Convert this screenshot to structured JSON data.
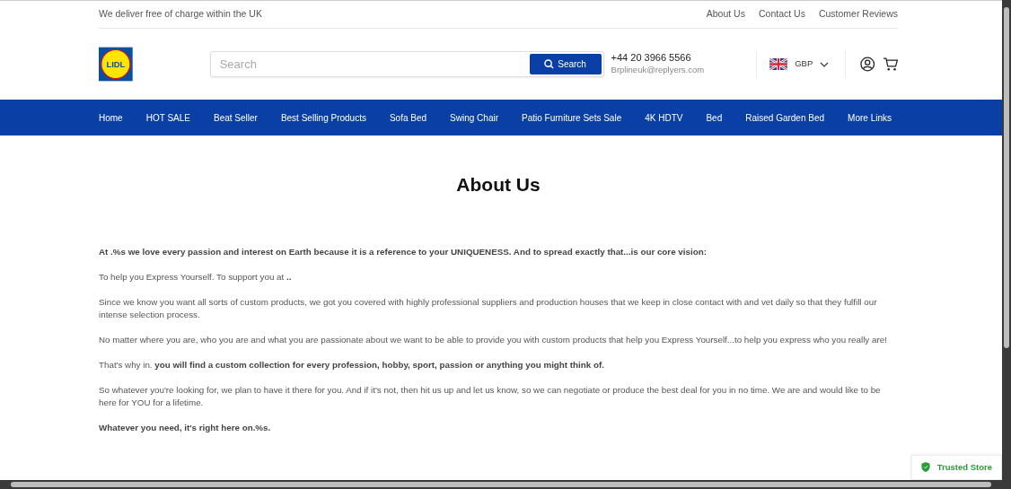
{
  "topbar": {
    "message": "We deliver free of charge within the UK",
    "links": [
      "About Us",
      "Contact Us",
      "Customer Reviews"
    ]
  },
  "header": {
    "logo": {
      "text": "LIDL"
    },
    "search": {
      "placeholder": "Search",
      "button": "Search"
    },
    "contact": {
      "phone": "+44 20 3966 5566",
      "email": "Brplineuk@replyers.com"
    },
    "currency": "GBP"
  },
  "nav": [
    "Home",
    "HOT SALE",
    "Beat Seller",
    "Best Selling Products",
    "Sofa Bed",
    "Swing Chair",
    "Patio Furniture Sets Sale",
    "4K HDTV",
    "Bed",
    "Raised Garden Bed",
    "More Links"
  ],
  "page": {
    "title": "About Us",
    "paragraphs": [
      {
        "text": "At .%s we love every passion and interest on Earth because it is a reference to your UNIQUENESS. And to spread exactly that...is our core vision:",
        "bold": true
      },
      {
        "text": "To help you Express Yourself. To support you at **..**",
        "bold": false
      },
      {
        "text": "Since we know you want all sorts of custom products, we got you covered with highly professional suppliers and production houses that we keep in close contact with and vet daily so that they fulfill our intense selection process.",
        "bold": false
      },
      {
        "text": "No matter where you are, who you are and what you are passionate about we want to be able to provide you with custom products that help you Express Yourself...to help you express who you really are!",
        "bold": false
      },
      {
        "text": "That's why in. **you will find a custom collection for every profession, hobby, sport, passion or anything you might think of.**",
        "bold": false
      },
      {
        "text": "So whatever you're looking for, we plan to have it there for you. And if it's not, then hit us up and let us know, so we can negotiate or produce the best deal for you in no time. We are and would like to be here for YOU for a lifetime.",
        "bold": false
      },
      {
        "text": "Whatever you need, it's right here on.%s.",
        "bold": true
      }
    ]
  },
  "trust_badge": "Trusted Store"
}
